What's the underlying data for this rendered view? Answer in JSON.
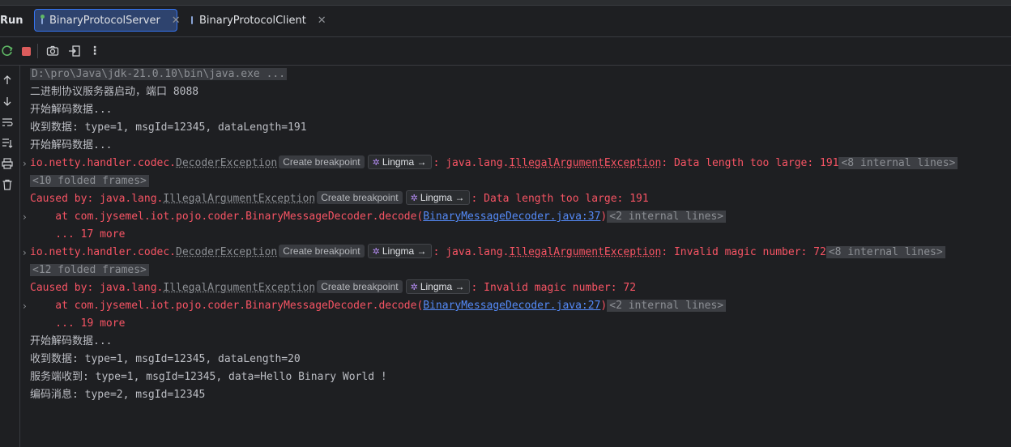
{
  "header": {
    "run_label": "Run",
    "tabs": [
      {
        "label": "BinaryProtocolServer",
        "active": true
      },
      {
        "label": "BinaryProtocolClient",
        "active": false
      }
    ]
  },
  "toolbar": {
    "buttons": [
      "rerun-icon",
      "stop-icon",
      "camera-icon",
      "exit-icon",
      "more-icon"
    ]
  },
  "sidebar": {
    "buttons": [
      "arrow-up-icon",
      "arrow-down-icon",
      "soft-wrap-icon",
      "scroll-to-end-icon",
      "print-icon",
      "trash-icon"
    ]
  },
  "pills": {
    "breakpoint": "Create breakpoint",
    "lingma": "Lingma →"
  },
  "console": {
    "l1_cmd": "D:\\pro\\Java\\jdk-21.0.10\\bin\\java.exe ...",
    "l2": "二进制协议服务器启动，端口 8088",
    "l3": "开始解码数据...",
    "l4": "收到数据: type=1, msgId=12345, dataLength=191",
    "l5": "开始解码数据...",
    "l6_prefix": "io.netty.handler.codec.",
    "l6_exc": "DecoderException",
    "l6_mid": ": java.lang.",
    "l6_exc2": "IllegalArgumentException",
    "l6_msg": ": Data length too large: 191",
    "l6_internal": "<8 internal lines>",
    "l7": "<10 folded frames>",
    "l8_prefix": "Caused by: java.lang.",
    "l8_exc": "IllegalArgumentException",
    "l8_msg": ": Data length too large: 191",
    "l9_pre": "    at com.jysemel.iot.pojo.coder.BinaryMessageDecoder.decode(",
    "l9_link": "BinaryMessageDecoder.java:37",
    "l9_post": ")",
    "l9_internal": "<2 internal lines>",
    "l10": "    ... 17 more",
    "l11_prefix": "io.netty.handler.codec.",
    "l11_exc": "DecoderException",
    "l11_mid": ": java.lang.",
    "l11_exc2": "IllegalArgumentException",
    "l11_msg": ": Invalid magic number: 72",
    "l11_internal": "<8 internal lines>",
    "l12": "<12 folded frames>",
    "l13_prefix": "Caused by: java.lang.",
    "l13_exc": "IllegalArgumentException",
    "l13_msg": ": Invalid magic number: 72",
    "l14_pre": "    at com.jysemel.iot.pojo.coder.BinaryMessageDecoder.decode(",
    "l14_link": "BinaryMessageDecoder.java:27",
    "l14_post": ")",
    "l14_internal": "<2 internal lines>",
    "l15": "    ... 19 more",
    "l16": "开始解码数据...",
    "l17": "收到数据: type=1, msgId=12345, dataLength=20",
    "l18": "服务端收到: type=1, msgId=12345, data=Hello Binary World !",
    "l19": "编码消息: type=2, msgId=12345"
  }
}
